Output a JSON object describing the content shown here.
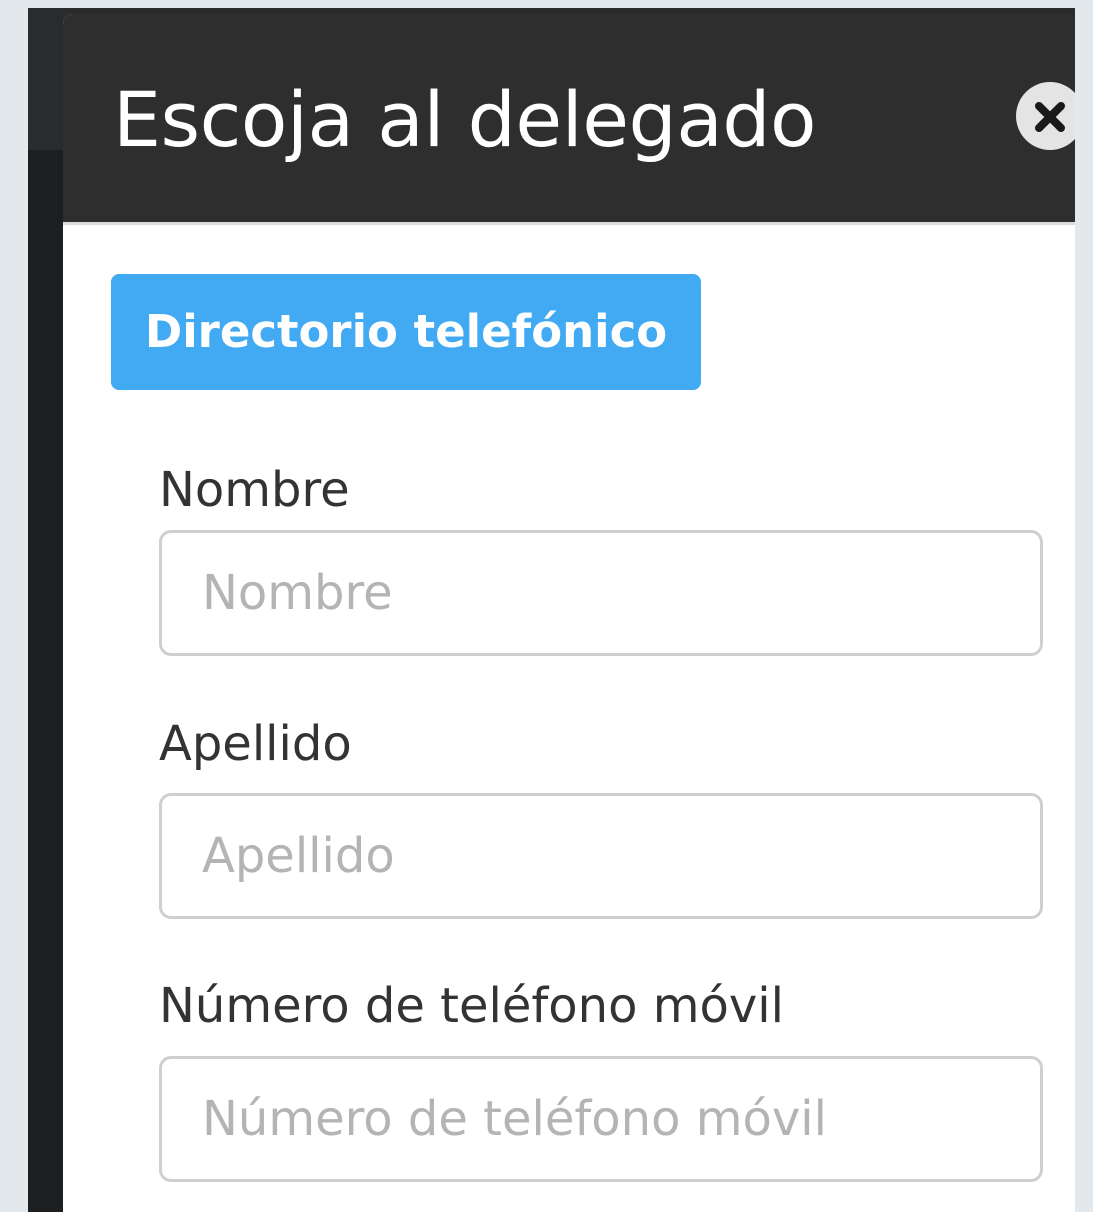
{
  "modal": {
    "title": "Escoja al delegado",
    "close_icon": "close-icon"
  },
  "directory_button": {
    "label": "Directorio telefónico"
  },
  "fields": {
    "first_name": {
      "label": "Nombre",
      "placeholder": "Nombre",
      "value": ""
    },
    "last_name": {
      "label": "Apellido",
      "placeholder": "Apellido",
      "value": ""
    },
    "mobile": {
      "label": "Número de teléfono móvil",
      "placeholder": "Número de teléfono móvil",
      "value": ""
    }
  },
  "colors": {
    "header_bg": "#2e2e2e",
    "button_bg": "#42a9f3",
    "page_bg": "#e3e8ec"
  }
}
